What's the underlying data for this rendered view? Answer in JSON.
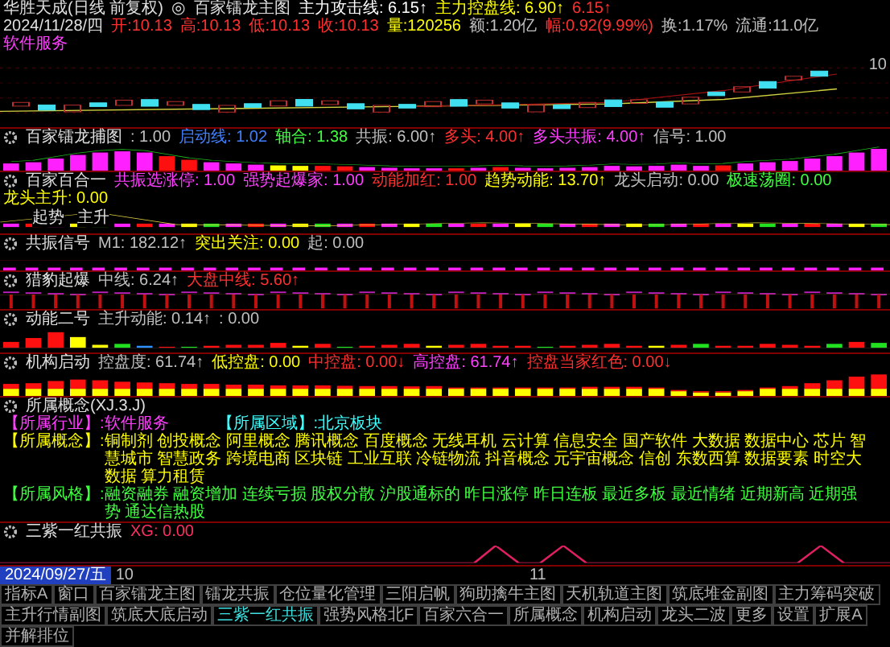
{
  "header": {
    "title": "华胜天成(日线 前复权)",
    "symbol": "◎",
    "indicator": "百家镭龙主图",
    "items": [
      {
        "text": "主力攻击线: 6.15↑",
        "color": "#ffffff"
      },
      {
        "text": "主力控盘线: 6.90↑",
        "color": "#ffff00"
      },
      {
        "text": "6.15↑",
        "color": "#ff3030"
      }
    ]
  },
  "quote": {
    "date": "2024/11/28/四",
    "items": [
      {
        "text": "开:10.13",
        "color": "#ff3030"
      },
      {
        "text": "高:10.13",
        "color": "#ff3030"
      },
      {
        "text": "低:10.13",
        "color": "#ff3030"
      },
      {
        "text": "收:10.13",
        "color": "#ff3030"
      },
      {
        "text": "量:120256",
        "color": "#ffff00"
      },
      {
        "text": "额:1.20亿",
        "color": "#c0c0c0"
      },
      {
        "text": "幅:0.92(9.99%)",
        "color": "#ff3030"
      },
      {
        "text": "换:1.17%",
        "color": "#c0c0c0"
      },
      {
        "text": "流通:11.0亿",
        "color": "#c0c0c0"
      },
      {
        "text": "软件服务",
        "color": "#ff40ff"
      }
    ]
  },
  "main_chart": {
    "price_label": "10"
  },
  "panels": [
    {
      "kind": "mixed-bars",
      "title": "百家镭龙捕图",
      "items": [
        {
          "text": ": 1.00",
          "color": "#c0c0c0"
        },
        {
          "text": "启动线: 1.02",
          "color": "#4080ff"
        },
        {
          "text": "轴合: 1.38",
          "color": "#40ff40"
        },
        {
          "text": "共振: 6.00↑",
          "color": "#c0c0c0"
        },
        {
          "text": "多头: 4.00↑",
          "color": "#ff3030"
        },
        {
          "text": "多头共振: 4.00↑",
          "color": "#ff40ff"
        },
        {
          "text": "信号: 1.00",
          "color": "#c0c0c0"
        }
      ]
    },
    {
      "kind": "line-strip",
      "title": "百家百合一",
      "chart_labels": [
        "起势",
        "主升"
      ],
      "items": [
        {
          "text": "共振选涨停: 1.00",
          "color": "#ff40ff"
        },
        {
          "text": "强势起爆家: 1.00",
          "color": "#ff40ff"
        },
        {
          "text": "动能加红: 1.00",
          "color": "#ff3030"
        },
        {
          "text": "趋势动能: 13.70↑",
          "color": "#ffff00"
        },
        {
          "text": "龙头启动: 0.00",
          "color": "#c0c0c0"
        },
        {
          "text": "极速荡圈: 0.00",
          "color": "#40ff40"
        },
        {
          "text": "龙头主升: 0.00",
          "color": "#ffff00"
        }
      ]
    },
    {
      "kind": "strip",
      "title": "共振信号",
      "items": [
        {
          "text": "M1: 182.12↑",
          "color": "#c0c0c0"
        },
        {
          "text": "突出关注: 0.00",
          "color": "#ffff00"
        },
        {
          "text": "起: 0.00",
          "color": "#c0c0c0"
        }
      ]
    },
    {
      "kind": "stems",
      "title": "猎豹起爆",
      "items": [
        {
          "text": "中线: 6.24↑",
          "color": "#c0c0c0"
        },
        {
          "text": "大盘中线: 5.60↑",
          "color": "#ff3030"
        }
      ]
    },
    {
      "kind": "small-bars",
      "title": "动能二号",
      "items": [
        {
          "text": "主升动能: 0.14↑",
          "color": "#c0c0c0"
        },
        {
          "text": ": 0.00",
          "color": "#c0c0c0"
        }
      ]
    },
    {
      "kind": "stacked-bars",
      "title": "机构启动",
      "items": [
        {
          "text": "控盘度: 61.74↑",
          "color": "#c0c0c0"
        },
        {
          "text": "低控盘: 0.00",
          "color": "#ffff00"
        },
        {
          "text": "中控盘: 0.00↓",
          "color": "#ff3030"
        },
        {
          "text": "高控盘: 61.74↑",
          "color": "#ff40ff"
        },
        {
          "text": "控盘当家红色: 0.00↓",
          "color": "#ff3030"
        }
      ]
    },
    {
      "kind": "concepts",
      "title": "所属概念(XJ.3.J)",
      "rows": [
        [
          {
            "label": "【所属行业】:",
            "value": "软件服务",
            "color": "#ff40ff"
          },
          {
            "label": "【所属区域】:",
            "value": "北京板块",
            "color": "#40ffff"
          }
        ],
        [
          {
            "label": "【所属概念】:",
            "value": "铜制剂 创投概念 阿里概念 腾讯概念 百度概念 无线耳机 云计算 信息安全 国产软件 大数据 数据中心 芯片 智慧城市 智慧政务 跨境电商 区块链 工业互联 冷链物流 抖音概念 元宇宙概念 信创 东数西算 数据要素 时空大数据 算力租赁",
            "color": "#ffff00"
          }
        ],
        [
          {
            "label": "【所属风格】:",
            "value": "融资融券 融资增加 连续亏损 股权分散 沪股通标的 昨日涨停 昨日连板 最近多板 最近情绪 近期新高 近期强势 通达信热股",
            "color": "#40ff40"
          }
        ]
      ]
    },
    {
      "kind": "triangles",
      "title": "三紫一红共振",
      "items": [
        {
          "text": "XG: 0.00",
          "color": "#ff3060"
        }
      ]
    }
  ],
  "axis": {
    "labels": [
      "2024/09/27/五",
      "10",
      "11"
    ]
  },
  "tabs": [
    {
      "label": "指标A",
      "selected": false
    },
    {
      "label": "窗口",
      "selected": false
    },
    {
      "label": "百家镭龙主图",
      "selected": false
    },
    {
      "label": "镭龙共振",
      "selected": false
    },
    {
      "label": "仓位量化管理",
      "selected": false
    },
    {
      "label": "三阳启帆",
      "selected": false
    },
    {
      "label": "狗助擒牛主图",
      "selected": false
    },
    {
      "label": "天机轨道主图",
      "selected": false
    },
    {
      "label": "筑底堆金副图",
      "selected": false
    },
    {
      "label": "主力筹码突破",
      "selected": false
    },
    {
      "label": "主升行情副图",
      "selected": false
    },
    {
      "label": "筑底大底启动",
      "selected": false
    },
    {
      "label": "三紫一红共振",
      "selected": true
    },
    {
      "label": "强势风格北F",
      "selected": false
    },
    {
      "label": "百家六合一",
      "selected": false
    },
    {
      "label": "所属概念",
      "selected": false
    },
    {
      "label": "机构启动",
      "selected": false
    },
    {
      "label": "龙头二波",
      "selected": false
    },
    {
      "label": "更多",
      "selected": false
    },
    {
      "label": "设置",
      "selected": false
    },
    {
      "label": "扩展A",
      "selected": false
    },
    {
      "label": "并解排位",
      "selected": false
    }
  ]
}
